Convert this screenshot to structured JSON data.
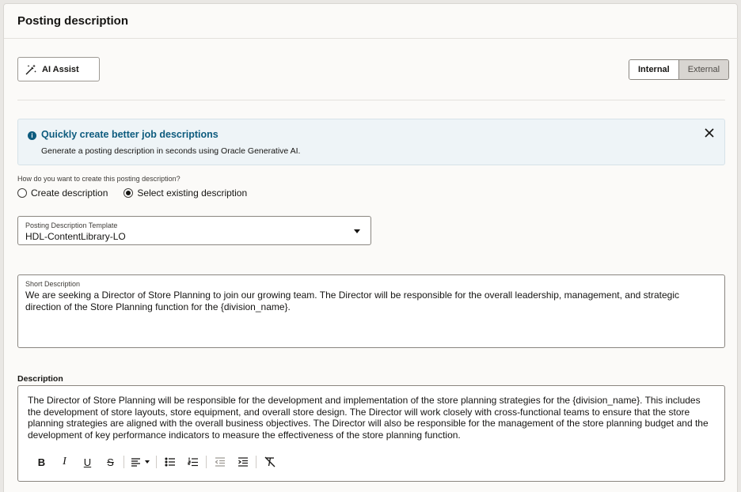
{
  "section": {
    "title": "Posting description"
  },
  "ai_assist": {
    "label": "AI Assist",
    "icon": "magic-wand-icon"
  },
  "visibility_toggle": {
    "options": [
      "Internal",
      "External"
    ],
    "selected": "Internal"
  },
  "banner": {
    "icon": "info-icon",
    "title": "Quickly create better job descriptions",
    "text": "Generate a posting description in seconds using Oracle Generative AI.",
    "close_icon": "close-icon"
  },
  "creation_mode": {
    "question": "How do you want to create this posting description?",
    "options": [
      {
        "label": "Create description",
        "checked": false
      },
      {
        "label": "Select existing description",
        "checked": true
      }
    ]
  },
  "template_select": {
    "label": "Posting Description Template",
    "value": "HDL-ContentLibrary-LO"
  },
  "short_description": {
    "label": "Short Description",
    "value": "We are seeking a Director of Store Planning to join our growing team. The Director will be responsible for the overall leadership, management, and strategic direction of the Store Planning function for the {division_name}."
  },
  "description": {
    "label": "Description",
    "value": "The Director of Store Planning will be responsible for the development and implementation of the store planning strategies for the {division_name}. This includes the development of store layouts, store equipment, and overall store design. The Director will work closely with cross-functional teams to ensure that the store planning strategies are aligned with the overall business objectives. The Director will also be responsible for the management of the store planning budget and the development of key performance indicators to measure the effectiveness of the store planning function.",
    "toolbar": {
      "bold": "B",
      "italic": "I",
      "underline": "U",
      "strikethrough": "S",
      "icons": [
        "align-left-icon",
        "bullet-list-icon",
        "numbered-list-icon",
        "outdent-icon",
        "indent-icon",
        "clear-format-icon"
      ]
    }
  },
  "colors": {
    "accent": "#0d5b7e",
    "banner_bg": "#eef4f7",
    "border": "#8a8680"
  }
}
